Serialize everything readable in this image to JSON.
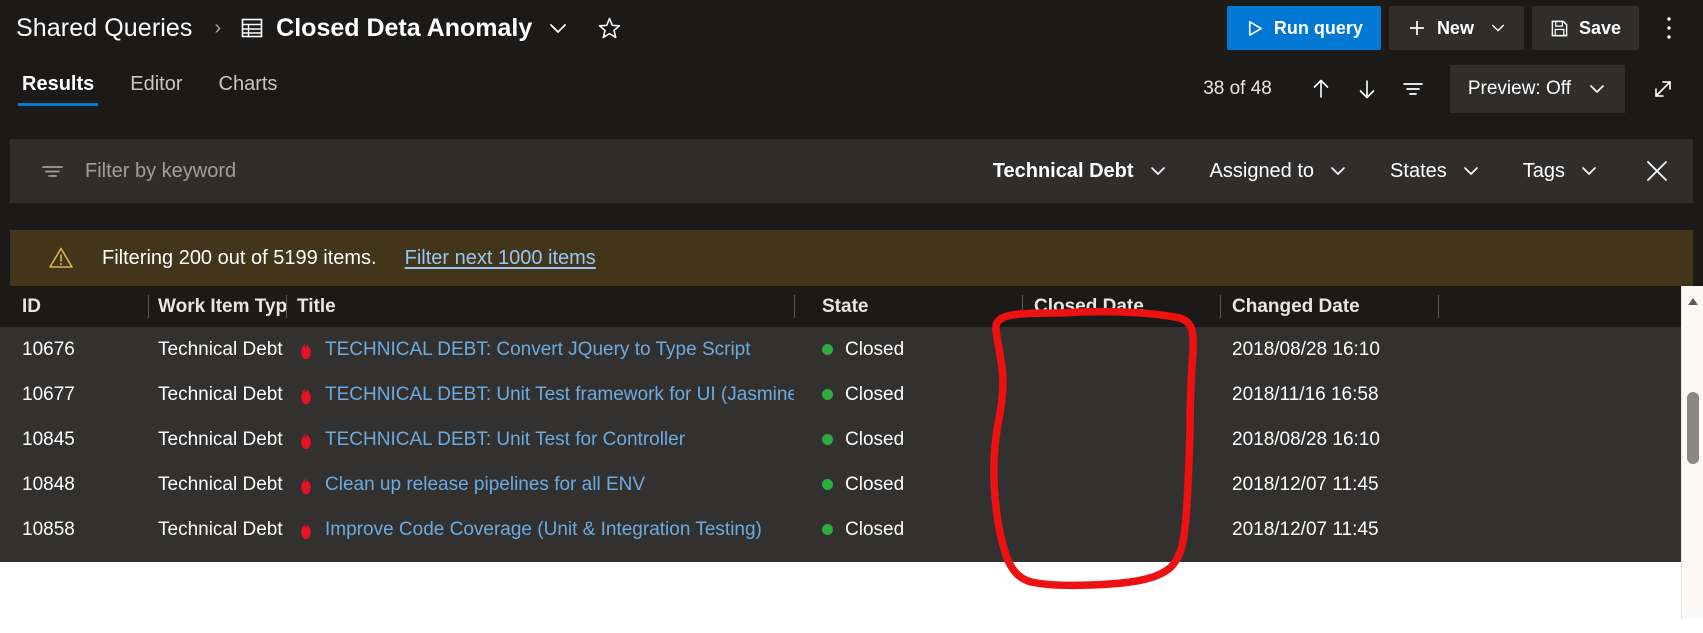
{
  "theme": {
    "accent": "#0078d4",
    "page_bg": "#1b1a19",
    "surface": "#2f2e2d",
    "grid_bg": "#323130",
    "banner_bg": "#433519",
    "link": "#6cabe0",
    "state_green": "#2faa3f",
    "ink_red": "#ee1111"
  },
  "commandbar": {
    "breadcrumb_root": "Shared Queries",
    "breadcrumb_separator": "›",
    "query_icon": "query-list-icon",
    "query_title": "Closed Deta Anomaly",
    "title_dropdown_icon": "chevron-down-icon",
    "favorite_icon": "star-outline-icon",
    "run_query_label": "Run query",
    "run_query_icon": "play-triangle-icon",
    "new_label": "New",
    "new_icon": "plus-icon",
    "new_dropdown_icon": "chevron-down-icon",
    "save_label": "Save",
    "save_icon": "floppy-disk-icon",
    "overflow_icon": "more-vertical-icon"
  },
  "pivot": {
    "tabs": [
      {
        "label": "Results",
        "active": true
      },
      {
        "label": "Editor",
        "active": false
      },
      {
        "label": "Charts",
        "active": false
      }
    ],
    "counter": "38 of 48",
    "prev_icon": "arrow-up-icon",
    "next_icon": "arrow-down-icon",
    "filter_icon": "filter-icon",
    "preview_label": "Preview: Off",
    "preview_dropdown_icon": "chevron-down-icon",
    "fullscreen_icon": "expand-diagonal-icon"
  },
  "filterbar": {
    "keyword_icon": "filter-icon",
    "keyword_placeholder": "Filter by keyword",
    "keyword_value": "",
    "pills": [
      {
        "label": "Technical Debt",
        "bold": true,
        "icon": "chevron-down-icon"
      },
      {
        "label": "Assigned to",
        "bold": false,
        "icon": "chevron-down-icon"
      },
      {
        "label": "States",
        "bold": false,
        "icon": "chevron-down-icon"
      },
      {
        "label": "Tags",
        "bold": false,
        "icon": "chevron-down-icon"
      }
    ],
    "close_icon": "close-x-icon"
  },
  "banner": {
    "warning_icon": "warning-triangle-icon",
    "message": "Filtering 200 out of 5199 items.",
    "link_label": "Filter next 1000 items"
  },
  "grid": {
    "columns": [
      "ID",
      "Work Item Type",
      "Title",
      "State",
      "Closed Date",
      "Changed Date"
    ],
    "rows": [
      {
        "id": "10676",
        "type": "Technical Debt",
        "type_icon": "flame-icon",
        "title": "TECHNICAL DEBT: Convert JQuery to Type Script",
        "state": "Closed",
        "closed_date": "",
        "changed_date": "2018/08/28 16:10"
      },
      {
        "id": "10677",
        "type": "Technical Debt",
        "type_icon": "flame-icon",
        "title": "TECHNICAL DEBT: Unit Test framework for UI (Jasmine ...",
        "state": "Closed",
        "closed_date": "",
        "changed_date": "2018/11/16 16:58"
      },
      {
        "id": "10845",
        "type": "Technical Debt",
        "type_icon": "flame-icon",
        "title": "TECHNICAL DEBT: Unit Test for Controller",
        "state": "Closed",
        "closed_date": "",
        "changed_date": "2018/08/28 16:10"
      },
      {
        "id": "10848",
        "type": "Technical Debt",
        "type_icon": "flame-icon",
        "title": "Clean up release pipelines for all ENV",
        "state": "Closed",
        "closed_date": "",
        "changed_date": "2018/12/07 11:45"
      },
      {
        "id": "10858",
        "type": "Technical Debt",
        "type_icon": "flame-icon",
        "title": "Improve Code Coverage (Unit & Integration Testing)",
        "state": "Closed",
        "closed_date": "",
        "changed_date": "2018/12/07 11:45"
      }
    ]
  },
  "scrollbar": {
    "up_arrow_icon": "scroll-up-arrow-icon",
    "thumb": "scroll-thumb"
  },
  "annotation": {
    "shape": "hand-drawn-red-circle",
    "target": "Closed Date column (empty values)"
  }
}
